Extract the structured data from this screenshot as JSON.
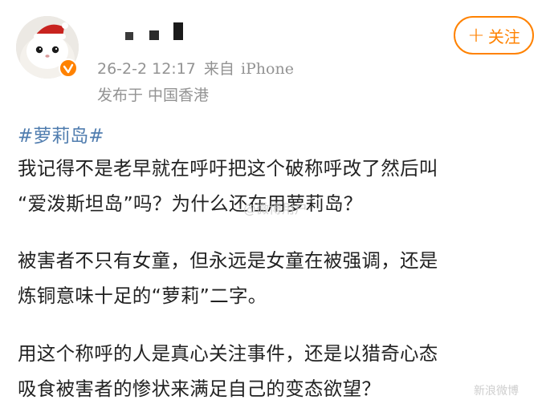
{
  "post": {
    "username_masked": "",
    "timestamp": "26-2-2 12:17",
    "source_label": "来自",
    "source_device": "iPhone",
    "location": "发布于 中国香港",
    "follow_label": "关注",
    "topic": "#萝莉岛#",
    "paragraphs": [
      [
        "我记得不是老早就在呼吁把这个破称呼改了然后叫",
        "“爱泼斯坦岛”吗？为什么还在用萝莉岛？"
      ],
      [
        "被害者不只有女童，但永远是女童在被强调，还是",
        "炼铜意味十足的“萝莉”二字。"
      ],
      [
        "用这个称呼的人是真心关注事件，还是以猎奇心态",
        "吸食被害者的惨状来满足自己的变态欲望？"
      ]
    ],
    "watermark_center": "@微博用户",
    "watermark_corner": "新浪微博"
  },
  "colors": {
    "accent": "#ff8200",
    "topic": "#507daf",
    "meta": "#939393",
    "text": "#222222"
  }
}
